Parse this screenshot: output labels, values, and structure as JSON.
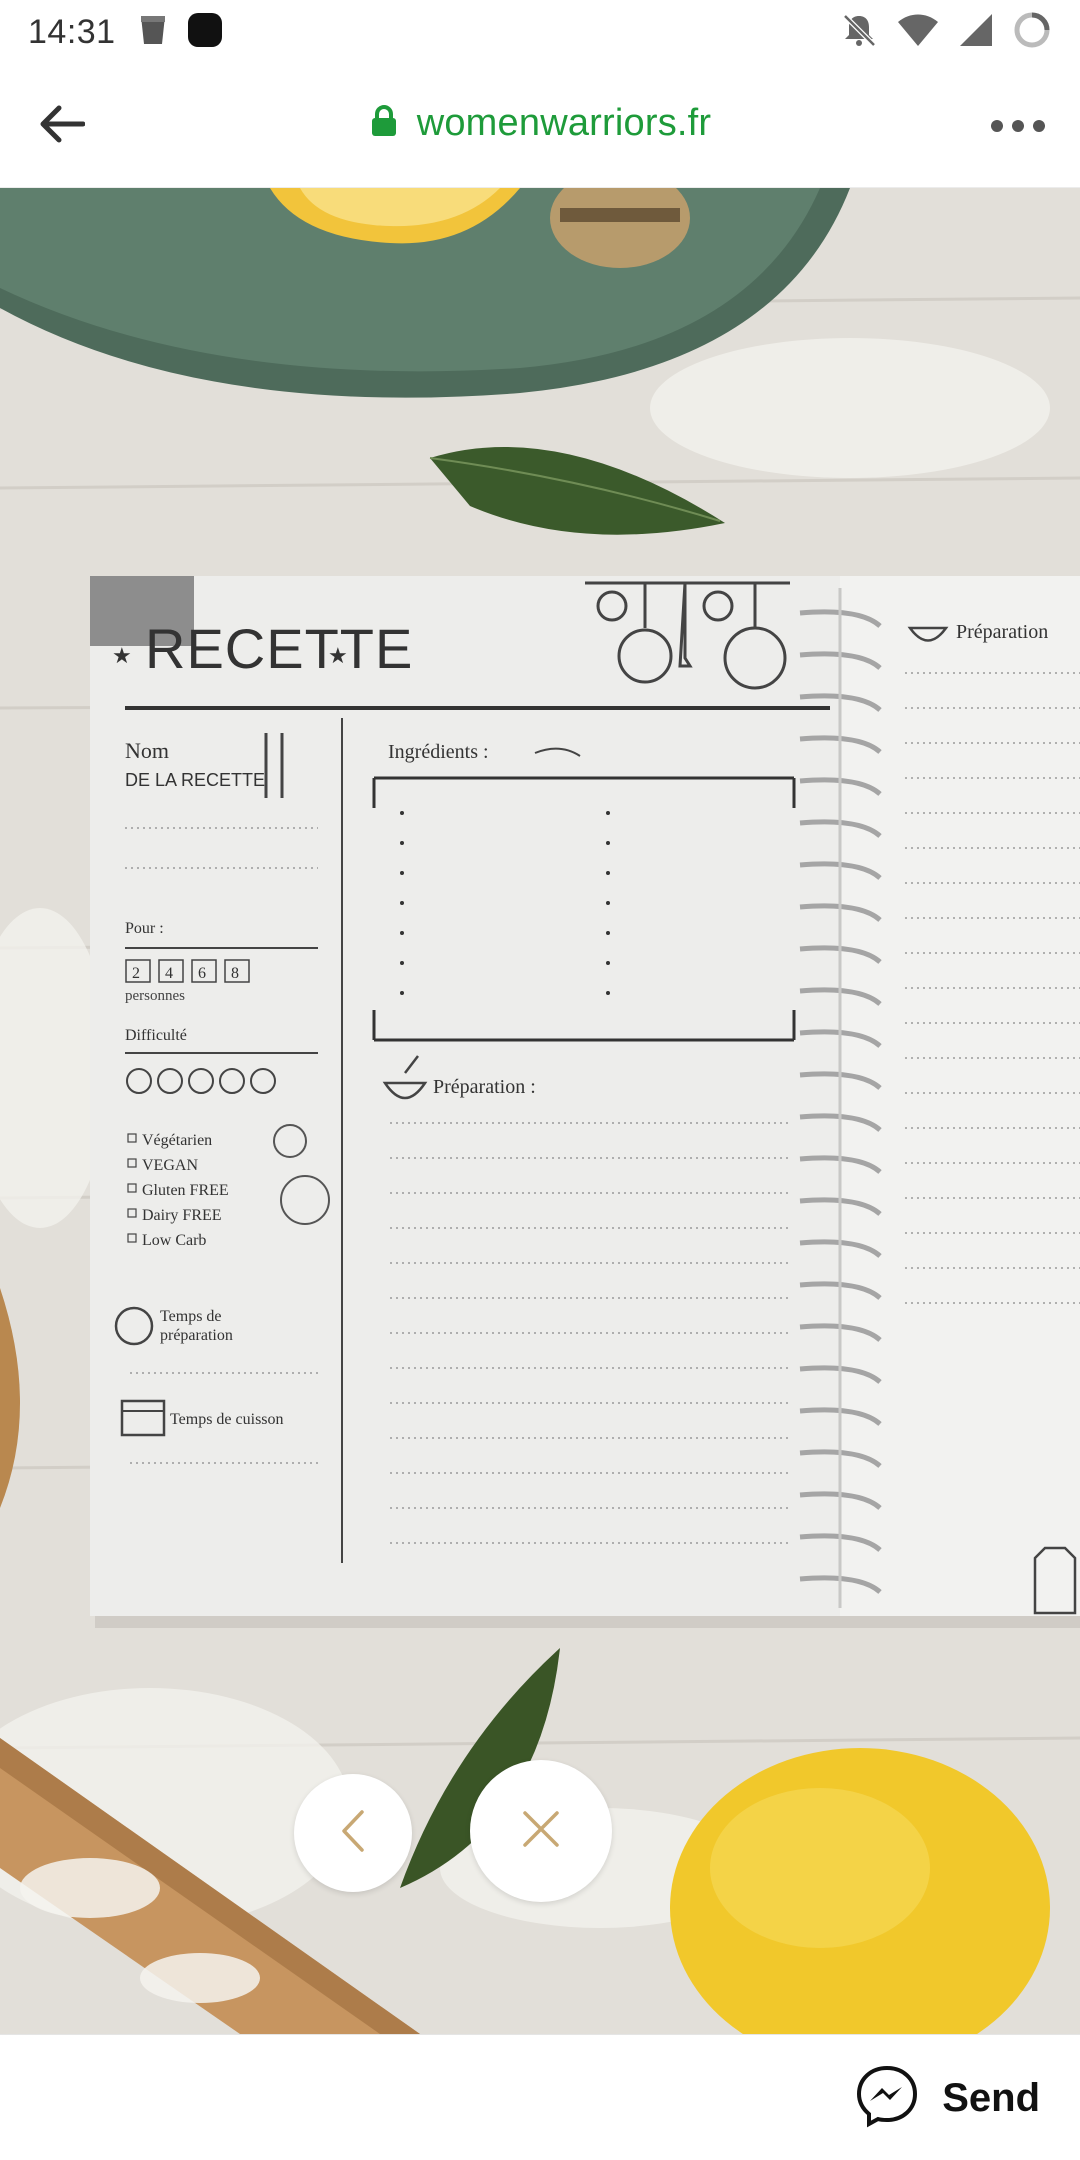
{
  "status_bar": {
    "time": "14:31"
  },
  "browser": {
    "domain": "womenwarriors.fr",
    "secure_color": "#1e9b3a"
  },
  "photo": {
    "page_title": "RECETTE",
    "recipe_name_label_1": "Nom",
    "recipe_name_label_2": "DE LA RECETTE",
    "pour_label": "Pour :",
    "people_options": [
      "2",
      "4",
      "6",
      "8"
    ],
    "people_label": "personnes",
    "difficulty_label": "Difficulté",
    "diet_options": [
      "Végétarien",
      "VEGAN",
      "Gluten FREE",
      "Dairy FREE",
      "Low Carb"
    ],
    "prep_time_label_1": "Temps de",
    "prep_time_label_2": "préparation",
    "cook_time_label": "Temps de cuisson",
    "ingredients_label": "Ingrédients :",
    "preparation_label": "Préparation :",
    "right_page_label": "Préparation"
  },
  "controls": {
    "prev": "previous-image",
    "close": "close-viewer"
  },
  "bottom_bar": {
    "send_label": "Send"
  }
}
